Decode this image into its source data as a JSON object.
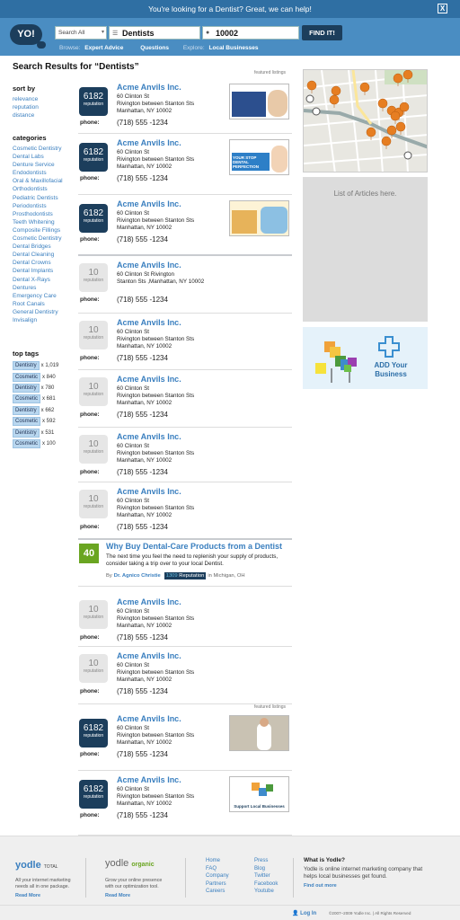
{
  "banner": {
    "message": "You're looking for a Dentist?  Great, we can help!",
    "close": "X"
  },
  "header": {
    "logo": "YO!",
    "logo_badge": "Yodle",
    "scope": "Search All",
    "query": "Dentists",
    "location": "10002",
    "find_label": "FIND IT!",
    "browse_label": "Browse:",
    "browse_links": [
      "Expert Advice",
      "Questions"
    ],
    "explore_label": "Explore:",
    "explore_link": "Local Businesses"
  },
  "results_title": "Search Results for “Dentists”",
  "featured_label": "featured listings",
  "sort": {
    "heading": "sort by",
    "options": [
      "relevance",
      "reputation",
      "distance"
    ]
  },
  "categories": {
    "heading": "categories",
    "items": [
      "Cosmetic Dentistry",
      "Dental Labs",
      "Denture Service",
      "Endodontists",
      "Oral & Maxillofacial",
      "Orthodontists",
      "Pediatric Dentists",
      "Periodontists",
      "Prosthodontists",
      "Teeth Whitening",
      "Composite Fillings",
      "Cosmetic Dentistry",
      "Dental Bridges",
      "Dental Cleaning",
      "Dental Crowns",
      "Dental Implants",
      "Dental X-Rays",
      "Dentures",
      "Emergency Care",
      "Root Canals",
      "General Dentistry",
      "Invisalign"
    ]
  },
  "top_tags": {
    "heading": "top tags",
    "items": [
      {
        "tag": "Dentistry",
        "count": "x 1,019"
      },
      {
        "tag": "Cosmetic",
        "count": "x 840"
      },
      {
        "tag": "Dentistry",
        "count": "x 780"
      },
      {
        "tag": "Cosmetic",
        "count": "x 681"
      },
      {
        "tag": "Dentistry",
        "count": "x 662"
      },
      {
        "tag": "Cosmetic",
        "count": "x 592"
      },
      {
        "tag": "Dentistry",
        "count": "x 531"
      },
      {
        "tag": "Cosmetic",
        "count": "x 100"
      }
    ]
  },
  "listings": [
    {
      "score": "6182",
      "rep_label": "reputation",
      "name": "Acme Anvils Inc.",
      "address": [
        "60 Clinton St",
        "Rivington between Stanton Sts",
        "Manhattan, NY 10002"
      ],
      "phone_label": "phone:",
      "phone": "(718) 555 -1234"
    },
    {
      "score": "6182",
      "rep_label": "reputation",
      "name": "Acme Anvils Inc.",
      "address": [
        "60 Clinton St",
        "Rivington between Stanton Sts",
        "Manhattan, NY 10002"
      ],
      "phone_label": "phone:",
      "phone": "(718) 555 -1234",
      "thumb_text": "YOUR STOP DENTAL PERFECTION"
    },
    {
      "score": "6182",
      "rep_label": "reputation",
      "name": "Acme Anvils Inc.",
      "address": [
        "60 Clinton St",
        "Rivington between Stanton Sts",
        "Manhattan, NY 10002"
      ],
      "phone_label": "phone:",
      "phone": "(718) 555 -1234"
    },
    {
      "score": "10",
      "rep_label": "reputation",
      "name": "Acme Anvils Inc.",
      "address": [
        "60 Clinton St Rivington",
        "Stanton Sts ,Manhattan, NY 10002"
      ],
      "phone_label": "phone:",
      "phone": "(718) 555 -1234"
    },
    {
      "score": "10",
      "rep_label": "reputation",
      "name": "Acme Anvils Inc.",
      "address": [
        "60 Clinton St",
        "Rivington between Stanton Sts",
        "Manhattan, NY 10002"
      ],
      "phone_label": "phone:",
      "phone": "(718) 555 -1234"
    },
    {
      "score": "10",
      "rep_label": "reputation",
      "name": "Acme Anvils Inc.",
      "address": [
        "60 Clinton St",
        "Rivington between Stanton Sts",
        "Manhattan, NY 10002"
      ],
      "phone_label": "phone:",
      "phone": "(718) 555 -1234"
    },
    {
      "score": "10",
      "rep_label": "reputation",
      "name": "Acme Anvils Inc.",
      "address": [
        "60 Clinton St",
        "Rivington between Stanton Sts",
        "Manhattan, NY 10002"
      ],
      "phone_label": "phone:",
      "phone": "(718) 555 -1234"
    },
    {
      "score": "10",
      "rep_label": "reputation",
      "name": "Acme Anvils Inc.",
      "address": [
        "60 Clinton St",
        "Rivington between Stanton Sts",
        "Manhattan, NY 10002"
      ],
      "phone_label": "phone:",
      "phone": "(718) 555 -1234"
    },
    {
      "score": "10",
      "rep_label": "reputation",
      "name": "Acme Anvils Inc.",
      "address": [
        "60 Clinton St",
        "Rivington between Stanton Sts",
        "Manhattan, NY 10002"
      ],
      "phone_label": "phone:",
      "phone": "(718) 555 -1234"
    },
    {
      "score": "10",
      "rep_label": "reputation",
      "name": "Acme Anvils Inc.",
      "address": [
        "60 Clinton St",
        "Rivington between Stanton Sts",
        "Manhattan, NY 10002"
      ],
      "phone_label": "phone:",
      "phone": "(718) 555 -1234"
    },
    {
      "score": "6182",
      "rep_label": "reputation",
      "name": "Acme Anvils Inc.",
      "address": [
        "60 Clinton St",
        "Rivington between Stanton Sts",
        "Manhattan, NY 10002"
      ],
      "phone_label": "phone:",
      "phone": "(718) 555 -1234"
    },
    {
      "score": "6182",
      "rep_label": "reputation",
      "name": "Acme Anvils Inc.",
      "address": [
        "60 Clinton St",
        "Rivington between Stanton Sts",
        "Manhattan, NY 10002"
      ],
      "phone_label": "phone:",
      "phone": "(718) 555 -1234",
      "thumb_text": "Support Local Businesses"
    }
  ],
  "article": {
    "score": "40",
    "title": "Why Buy Dental-Care Products from a Dentist",
    "body": "The next time you feel the need to replenish your supply of products, consider taking a trip over to your local Dentist.",
    "by": "By",
    "author": "Dr. Agnico Christie",
    "rep_score": "1309",
    "rep_label": "Reputation",
    "in": "in",
    "location": "Michigan, OH"
  },
  "right": {
    "articles_placeholder": "List of Articles here.",
    "add_business": "ADD Your Business"
  },
  "footer": {
    "brand1": "yodle",
    "brand1_sub": "TOTAL",
    "desc1": [
      "All your internet marketing",
      "needs all in one package."
    ],
    "read_more": "Read More",
    "brand2": "yodle",
    "brand2_sub": "organic",
    "desc2": [
      "Grow your online presence",
      "with our optimization tool."
    ],
    "links1": [
      "Home",
      "FAQ",
      "Company",
      "Partners",
      "Careers"
    ],
    "links2": [
      "Press",
      "Blog",
      "Twitter",
      "Facebook",
      "Youtube"
    ],
    "what_heading": "What is Yodle?",
    "what_desc": "Yodle is online internet marketing company that helps local businesses get found.",
    "find_more": "Find out more",
    "login": "Log In",
    "copyright": "©2007–2009 Yodle Inc.  |  All Rights Reserved"
  },
  "colors": {
    "brand_blue": "#4a8dc2",
    "navy": "#1c3e5c",
    "link": "#3a7fbf",
    "article_green": "#6aa521",
    "pin": "#e67e22"
  }
}
